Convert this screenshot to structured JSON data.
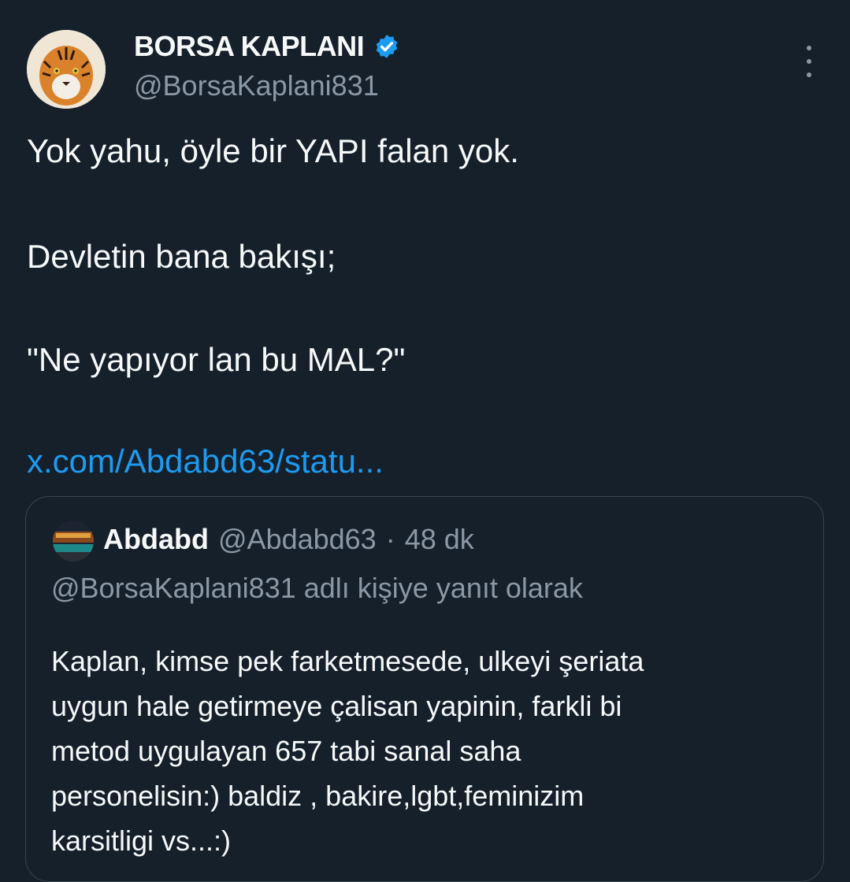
{
  "author": {
    "name": "BORSA KAPLANI",
    "handle": "@BorsaKaplani831",
    "verified": true,
    "avatar_icon": "tiger-avatar"
  },
  "menu": {
    "icon": "more-vertical-icon"
  },
  "tweet": {
    "lines": [
      "Yok yahu, öyle bir YAPI falan yok.",
      "Devletin bana bakışı;",
      "\"Ne yapıyor lan bu MAL?\""
    ],
    "link": "x.com/Abdabd63/statu..."
  },
  "quote": {
    "name": "Abdabd",
    "handle": "@Abdabd63",
    "separator": "·",
    "time": "48 dk",
    "reply_to": "@BorsaKaplani831 adlı kişiye yanıt olarak",
    "text_lines": [
      "Kaplan, kimse pek farketmesede, ulkeyi şeriata",
      "uygun hale getirmeye çalisan yapinin, farkli bi",
      "metod uygulayan 657 tabi sanal saha",
      "personelisin:) baldiz , bakire,lgbt,feminizim",
      "karsitligi vs...:)"
    ]
  },
  "colors": {
    "background": "#15202b",
    "text": "#f7f9f9",
    "muted": "#8b98a5",
    "link": "#1d9bf0",
    "border": "#38444d",
    "verified": "#1d9bf0"
  }
}
